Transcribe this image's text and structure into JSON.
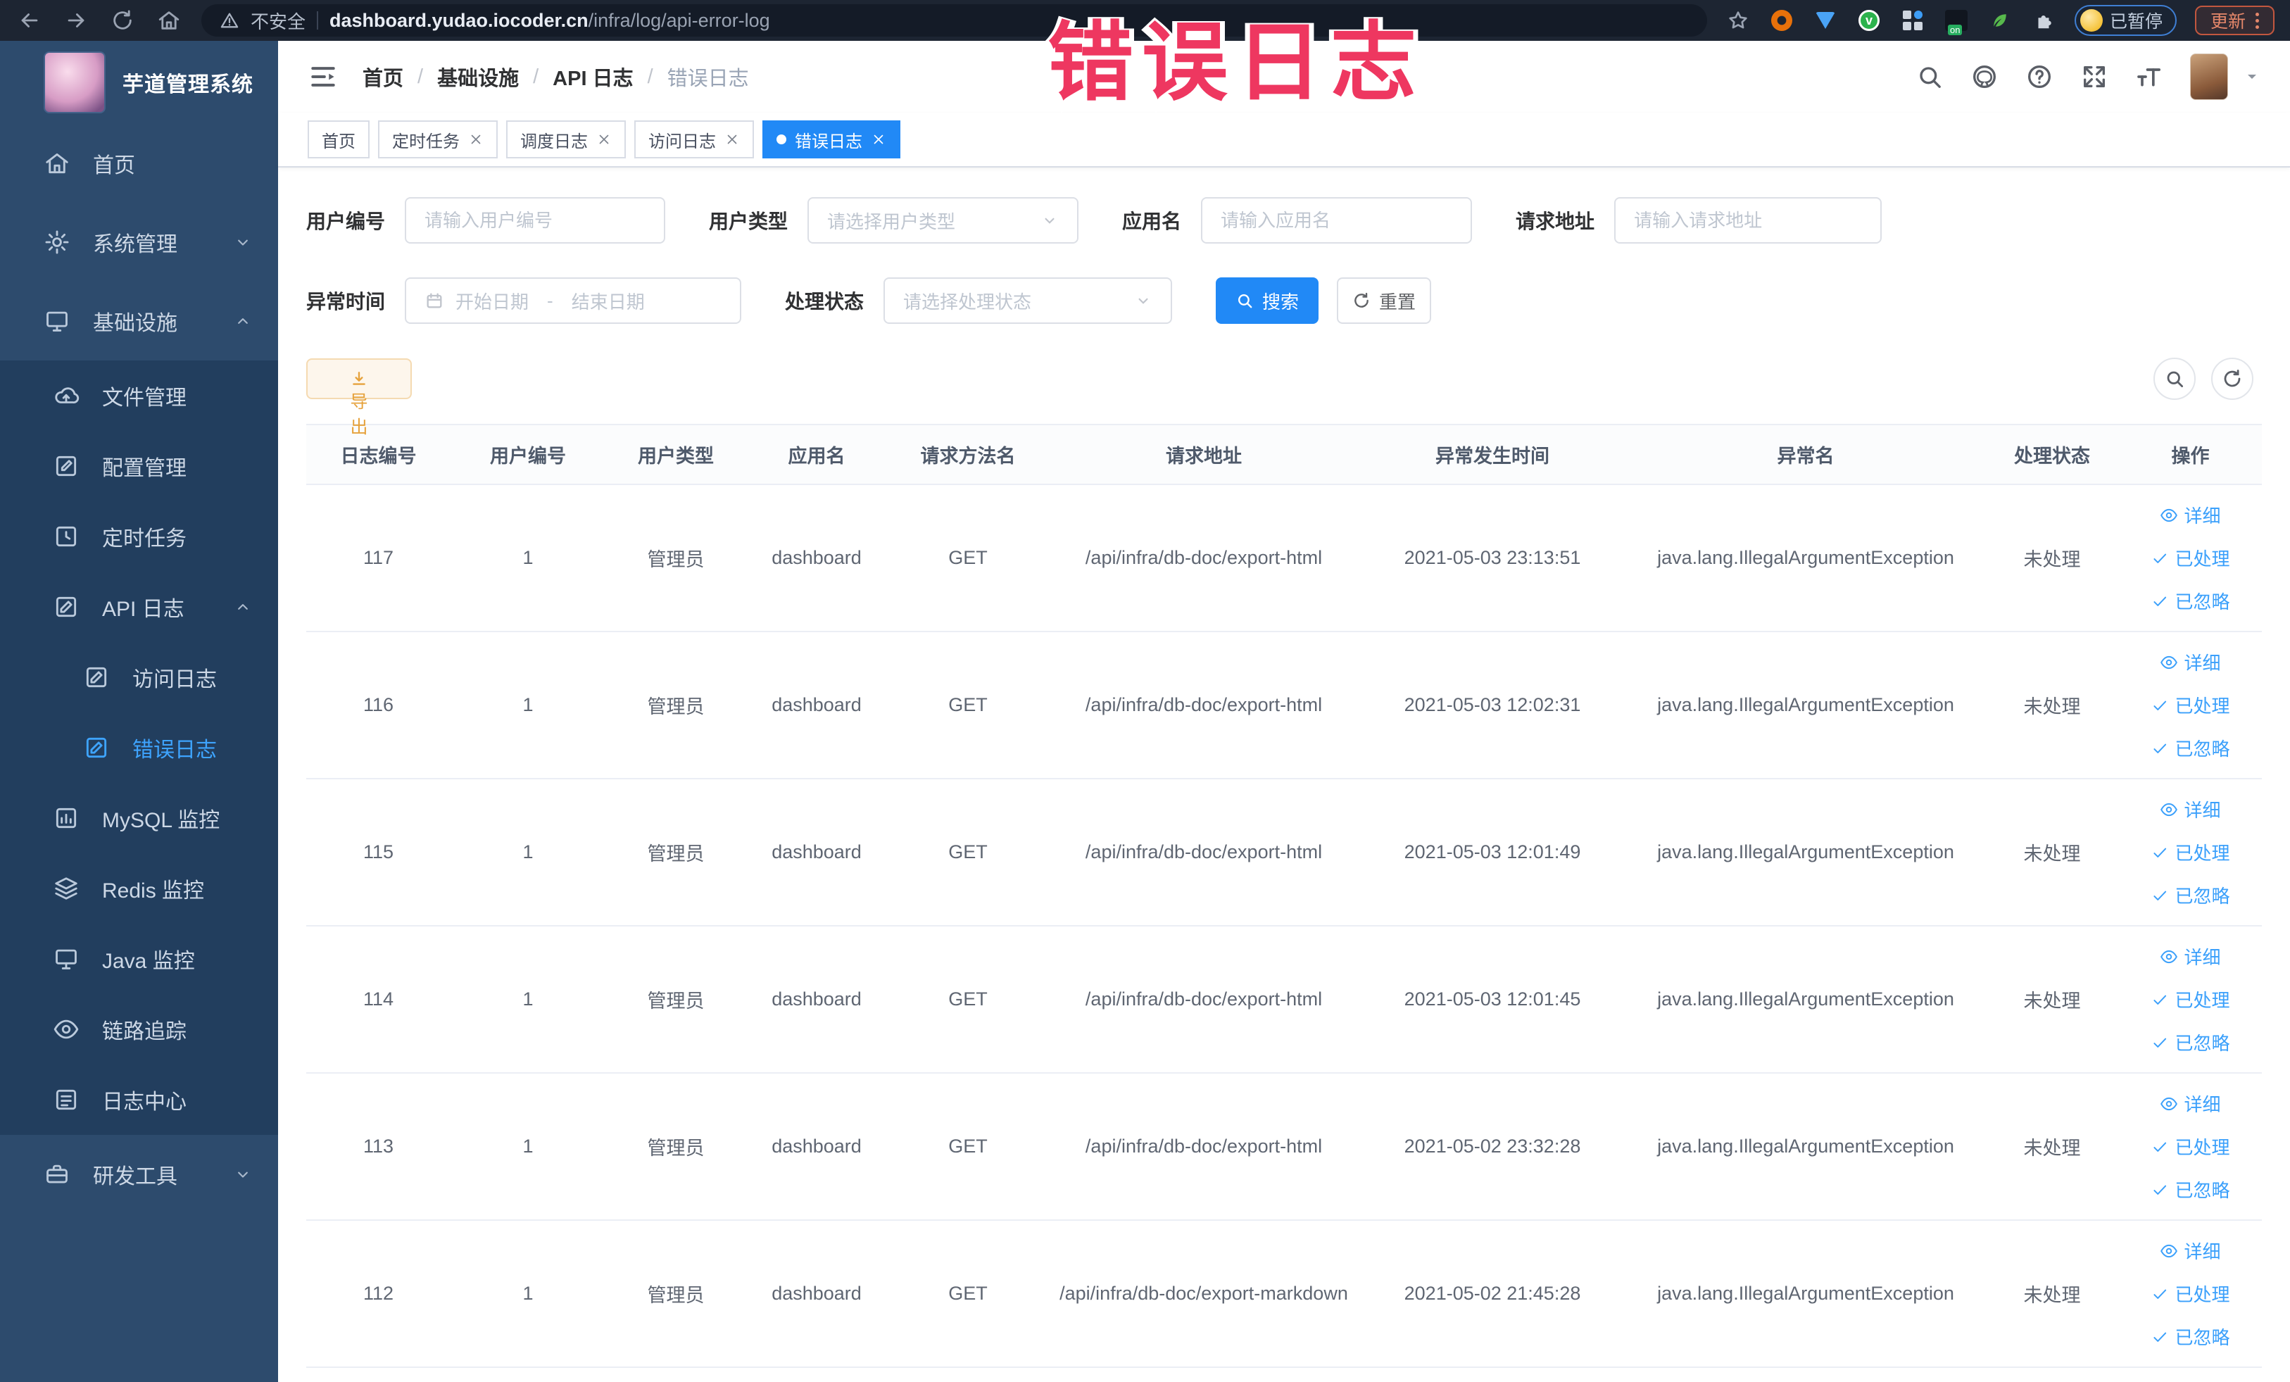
{
  "browser": {
    "security_label": "不安全",
    "url_host": "dashboard.yudao.iocoder.cn",
    "url_path": "/infra/log/api-error-log",
    "paused_chip": "已暂停",
    "update_button": "更新"
  },
  "annotation": {
    "text": "错误日志"
  },
  "sidebar": {
    "title": "芋道管理系统",
    "items": [
      {
        "label": "首页",
        "icon": "home-icon",
        "level": 1
      },
      {
        "label": "系统管理",
        "icon": "gear-icon",
        "level": 1,
        "chevron": "down"
      },
      {
        "label": "基础设施",
        "icon": "infra-icon",
        "level": 1,
        "chevron": "up"
      },
      {
        "label": "文件管理",
        "icon": "file-icon",
        "level": 2,
        "group": true
      },
      {
        "label": "配置管理",
        "icon": "config-icon",
        "level": 2,
        "group": true
      },
      {
        "label": "定时任务",
        "icon": "job-icon",
        "level": 2,
        "group": true
      },
      {
        "label": "API 日志",
        "icon": "api-log-icon",
        "level": 2,
        "group": true,
        "chevron": "up"
      },
      {
        "label": "访问日志",
        "icon": "access-log-icon",
        "level": 3,
        "group": true
      },
      {
        "label": "错误日志",
        "icon": "error-log-icon",
        "level": 3,
        "group": true,
        "active": true
      },
      {
        "label": "MySQL 监控",
        "icon": "mysql-icon",
        "level": 2,
        "group": true
      },
      {
        "label": "Redis 监控",
        "icon": "redis-icon",
        "level": 2,
        "group": true
      },
      {
        "label": "Java 监控",
        "icon": "java-icon",
        "level": 2,
        "group": true
      },
      {
        "label": "链路追踪",
        "icon": "trace-icon",
        "level": 2,
        "group": true
      },
      {
        "label": "日志中心",
        "icon": "log-center-icon",
        "level": 2,
        "group": true
      },
      {
        "label": "研发工具",
        "icon": "devtools-icon",
        "level": 1,
        "chevron": "down"
      }
    ]
  },
  "breadcrumb": {
    "items": [
      "首页",
      "基础设施",
      "API 日志",
      "错误日志"
    ]
  },
  "tabs": [
    {
      "label": "首页"
    },
    {
      "label": "定时任务",
      "closable": true
    },
    {
      "label": "调度日志",
      "closable": true
    },
    {
      "label": "访问日志",
      "closable": true
    },
    {
      "label": "错误日志",
      "closable": true,
      "active": true
    }
  ],
  "filters": {
    "user_id": {
      "label": "用户编号",
      "placeholder": "请输入用户编号"
    },
    "user_type": {
      "label": "用户类型",
      "placeholder": "请选择用户类型"
    },
    "app_name": {
      "label": "应用名",
      "placeholder": "请输入应用名"
    },
    "request_url": {
      "label": "请求地址",
      "placeholder": "请输入请求地址"
    },
    "exception_time": {
      "label": "异常时间",
      "start_placeholder": "开始日期",
      "separator": "-",
      "end_placeholder": "结束日期"
    },
    "process_status": {
      "label": "处理状态",
      "placeholder": "请选择处理状态"
    },
    "search_button": "搜索",
    "reset_button": "重置"
  },
  "toolbar": {
    "export_button": "导出"
  },
  "table": {
    "columns": [
      "日志编号",
      "用户编号",
      "用户类型",
      "应用名",
      "请求方法名",
      "请求地址",
      "异常发生时间",
      "异常名",
      "处理状态",
      "操作"
    ],
    "actions": {
      "detail": "详细",
      "processed": "已处理",
      "ignored": "已忽略"
    },
    "rows": [
      {
        "id": "117",
        "user_id": "1",
        "user_type": "管理员",
        "app": "dashboard",
        "method": "GET",
        "url": "/api/infra/db-doc/export-html",
        "time": "2021-05-03 23:13:51",
        "exception": "java.lang.IllegalArgumentException",
        "status": "未处理"
      },
      {
        "id": "116",
        "user_id": "1",
        "user_type": "管理员",
        "app": "dashboard",
        "method": "GET",
        "url": "/api/infra/db-doc/export-html",
        "time": "2021-05-03 12:02:31",
        "exception": "java.lang.IllegalArgumentException",
        "status": "未处理"
      },
      {
        "id": "115",
        "user_id": "1",
        "user_type": "管理员",
        "app": "dashboard",
        "method": "GET",
        "url": "/api/infra/db-doc/export-html",
        "time": "2021-05-03 12:01:49",
        "exception": "java.lang.IllegalArgumentException",
        "status": "未处理"
      },
      {
        "id": "114",
        "user_id": "1",
        "user_type": "管理员",
        "app": "dashboard",
        "method": "GET",
        "url": "/api/infra/db-doc/export-html",
        "time": "2021-05-03 12:01:45",
        "exception": "java.lang.IllegalArgumentException",
        "status": "未处理"
      },
      {
        "id": "113",
        "user_id": "1",
        "user_type": "管理员",
        "app": "dashboard",
        "method": "GET",
        "url": "/api/infra/db-doc/export-html",
        "time": "2021-05-02 23:32:28",
        "exception": "java.lang.IllegalArgumentException",
        "status": "未处理"
      },
      {
        "id": "112",
        "user_id": "1",
        "user_type": "管理员",
        "app": "dashboard",
        "method": "GET",
        "url": "/api/infra/db-doc/export-markdown",
        "time": "2021-05-02 21:45:28",
        "exception": "java.lang.IllegalArgumentException",
        "status": "未处理"
      }
    ]
  },
  "colors": {
    "primary": "#2189f6",
    "link": "#3ba0fb",
    "warning": "#e6a23c",
    "annotation_red": "#ee3760",
    "sidebar_bg": "#2d4b6d",
    "submenu_bg": "#223e5e",
    "active_menu": "#3ea4ff"
  }
}
